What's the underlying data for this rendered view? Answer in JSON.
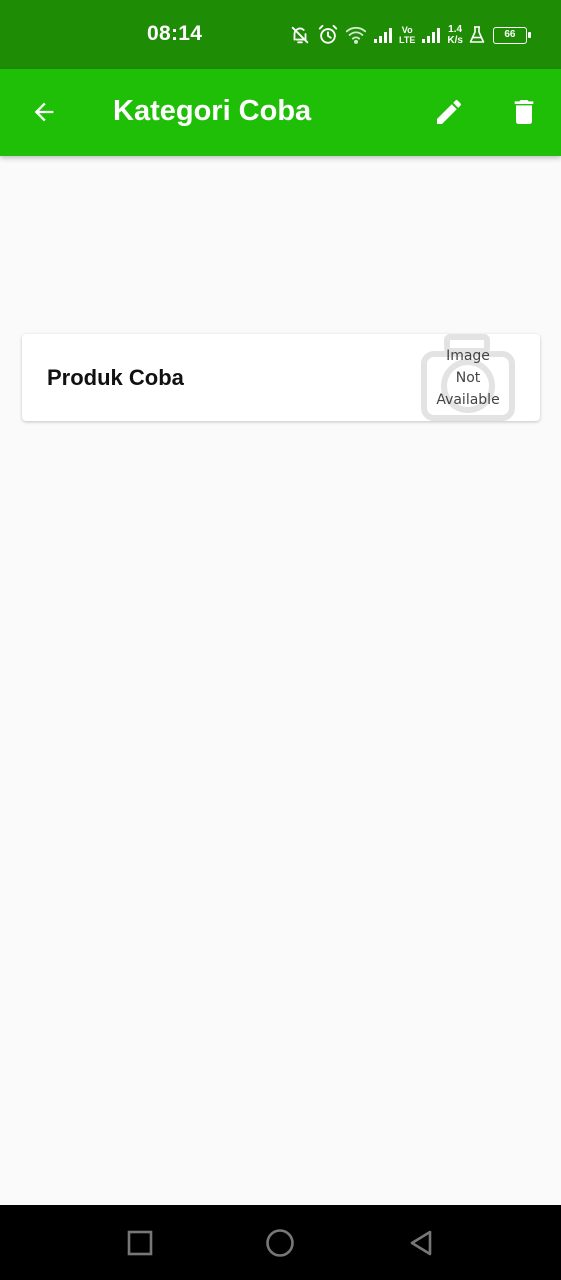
{
  "status_bar": {
    "time": "08:14",
    "network_label_top": "Vo",
    "network_label_bottom": "LTE",
    "speed_value": "1.4",
    "speed_unit": "K/s",
    "battery_level": "66",
    "icons": [
      "bell-off-icon",
      "alarm-icon",
      "wifi-icon",
      "signal-icon",
      "signal-icon",
      "flask-icon",
      "battery-icon"
    ]
  },
  "app_bar": {
    "title": "Kategori Coba",
    "background": "#1fbf07",
    "icons": [
      "arrow-back-icon",
      "pencil-icon",
      "trash-icon"
    ]
  },
  "products": [
    {
      "name": "Produk Coba",
      "image_placeholder": [
        "Image",
        "Not",
        "Available"
      ]
    }
  ],
  "nav_bar": {
    "icons": [
      "recent-apps-icon",
      "home-icon",
      "back-icon"
    ]
  },
  "colors": {
    "status_bar": "#1f8c06",
    "app_bar": "#1fbf07",
    "background": "#fafafa"
  }
}
